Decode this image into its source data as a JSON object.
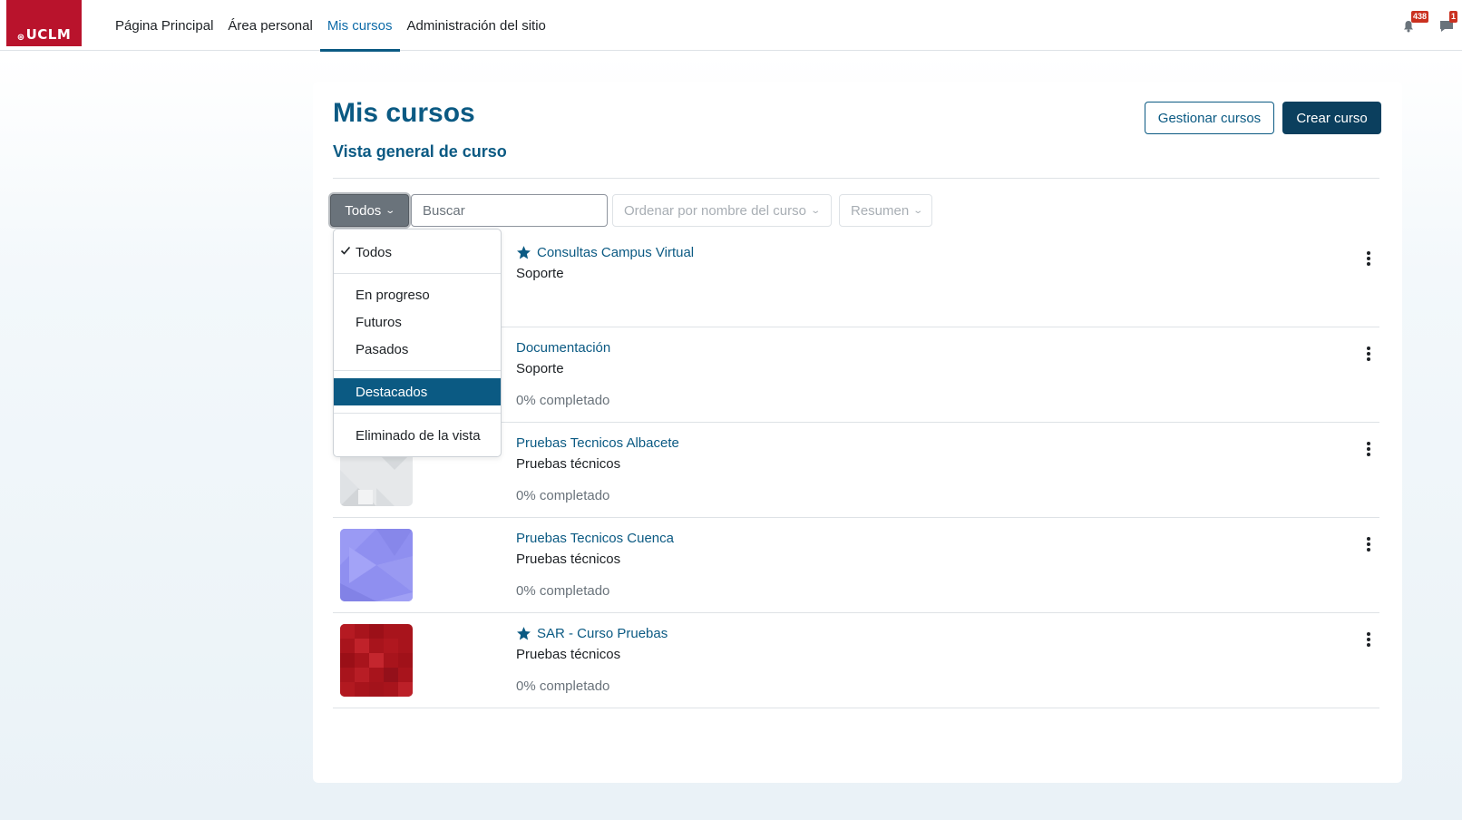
{
  "navbar": {
    "logo_text": "UCLM",
    "items": [
      {
        "label": "Página Principal",
        "active": false
      },
      {
        "label": "Área personal",
        "active": false
      },
      {
        "label": "Mis cursos",
        "active": true
      },
      {
        "label": "Administración del sitio",
        "active": false
      }
    ],
    "notifications_count": "438",
    "messages_count": "1"
  },
  "page": {
    "title": "Mis cursos",
    "subtitle": "Vista general de curso",
    "manage_button": "Gestionar cursos",
    "create_button": "Crear curso"
  },
  "controls": {
    "filter_label": "Todos",
    "search_placeholder": "Buscar",
    "sort_label": "Ordenar por nombre del curso",
    "view_label": "Resumen"
  },
  "filter_menu": {
    "items": [
      {
        "label": "Todos",
        "checked": true
      },
      {
        "label": "En progreso"
      },
      {
        "label": "Futuros"
      },
      {
        "label": "Pasados"
      },
      {
        "label": "Destacados",
        "highlighted": true
      },
      {
        "label": "Eliminado de la vista"
      }
    ]
  },
  "courses": [
    {
      "name": "Consultas Campus Virtual",
      "category": "Soporte",
      "progress": "",
      "starred": true,
      "thumb": "hidden"
    },
    {
      "name": "Documentación",
      "category": "Soporte",
      "progress": "0% completado",
      "starred": false,
      "thumb": "hidden"
    },
    {
      "name": "Pruebas Tecnicos Albacete",
      "category": "Pruebas técnicos",
      "progress": "0% completado",
      "starred": false,
      "thumb": "grey-pattern"
    },
    {
      "name": "Pruebas Tecnicos Cuenca",
      "category": "Pruebas técnicos",
      "progress": "0% completado",
      "starred": false,
      "thumb": "purple-pattern"
    },
    {
      "name": "SAR - Curso Pruebas",
      "category": "Pruebas técnicos",
      "progress": "0% completado",
      "starred": true,
      "thumb": "red-pattern"
    }
  ],
  "colors": {
    "brand": "#b9132c",
    "primary": "#0b5a83",
    "primary_dark": "#0b3f5e",
    "badge": "#ca3120"
  }
}
